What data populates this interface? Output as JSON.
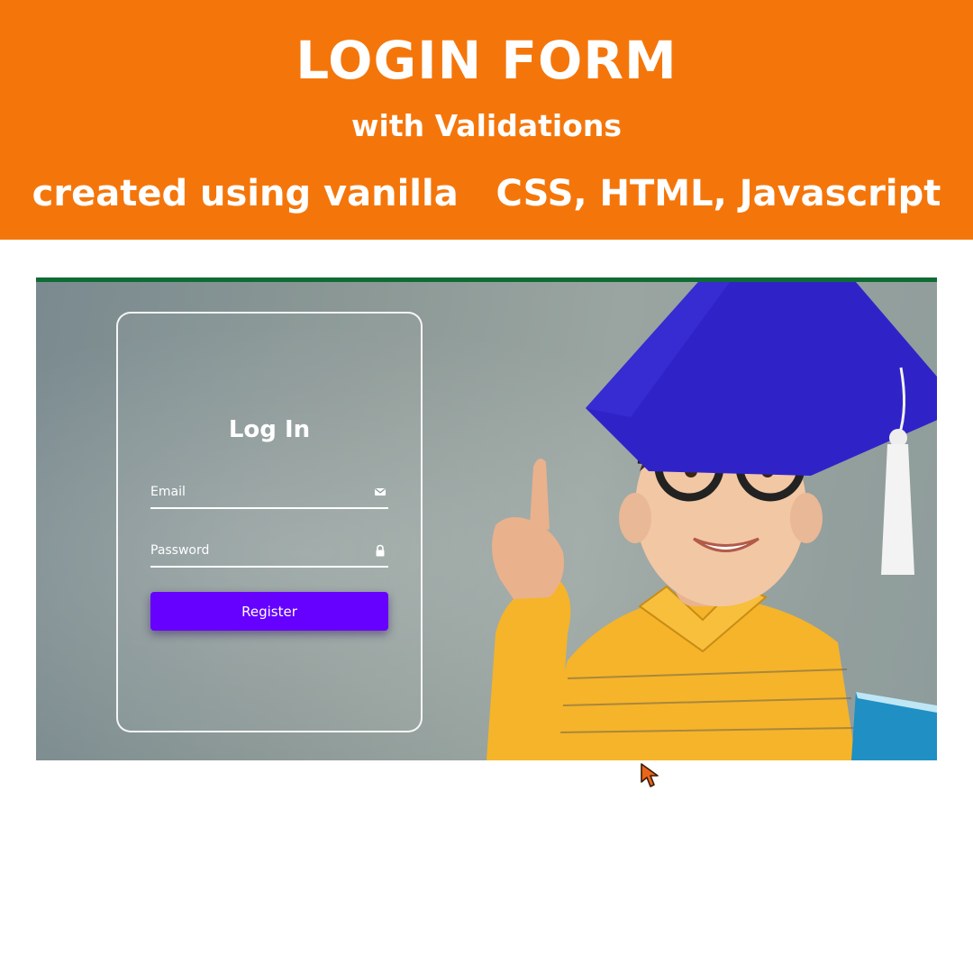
{
  "banner": {
    "title": "LOGIN FORM",
    "subtitle": "with Validations",
    "tagline": "created using vanilla   CSS, HTML, Javascript"
  },
  "login": {
    "heading": "Log In",
    "email_placeholder": "Email",
    "password_placeholder": "Password",
    "register_label": "Register",
    "email_icon": "envelope-icon",
    "password_icon": "lock-icon"
  },
  "colors": {
    "banner": "#f4760b",
    "button": "#6600ff",
    "topbar": "#0f6b34"
  }
}
